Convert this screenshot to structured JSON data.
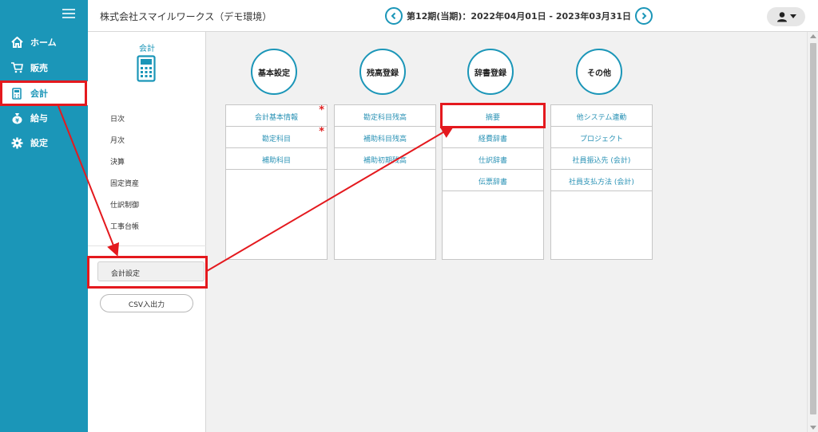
{
  "header": {
    "company": "株式会社スマイルワークス（デモ環境）",
    "period": "第12期(当期)：2022年04月01日 - 2023年03月31日"
  },
  "nav": {
    "items": [
      {
        "label": "ホーム",
        "icon": "home-icon"
      },
      {
        "label": "販売",
        "icon": "cart-icon"
      },
      {
        "label": "会計",
        "icon": "calculator-icon"
      },
      {
        "label": "給与",
        "icon": "money-bag-icon"
      },
      {
        "label": "設定",
        "icon": "gear-icon"
      }
    ],
    "active": "会計"
  },
  "subnav": {
    "title": "会計",
    "items": [
      "日次",
      "月次",
      "決算",
      "固定資産",
      "仕訳制御",
      "工事台帳"
    ],
    "settings": "会計設定",
    "csv": "CSV入出力"
  },
  "categories": [
    {
      "label": "基本設定",
      "items": [
        {
          "text": "会計基本情報",
          "required": true
        },
        {
          "text": "勘定科目",
          "required": true
        },
        {
          "text": "補助科目",
          "required": false
        }
      ]
    },
    {
      "label": "残高登録",
      "items": [
        {
          "text": "勘定科目残高"
        },
        {
          "text": "補助科目残高"
        },
        {
          "text": "補助初期残高"
        }
      ]
    },
    {
      "label": "辞書登録",
      "items": [
        {
          "text": "摘要"
        },
        {
          "text": "経費辞書"
        },
        {
          "text": "仕訳辞書"
        },
        {
          "text": "伝票辞書"
        }
      ]
    },
    {
      "label": "その他",
      "items": [
        {
          "text": "他システム連動"
        },
        {
          "text": "プロジェクト"
        },
        {
          "text": "社員振込先 (会計)"
        },
        {
          "text": "社員支払方法 (会計)"
        }
      ]
    }
  ],
  "required_mark": "*",
  "colors": {
    "accent": "#1b96b8",
    "annotation": "#e4191e",
    "required": "#e02020"
  }
}
